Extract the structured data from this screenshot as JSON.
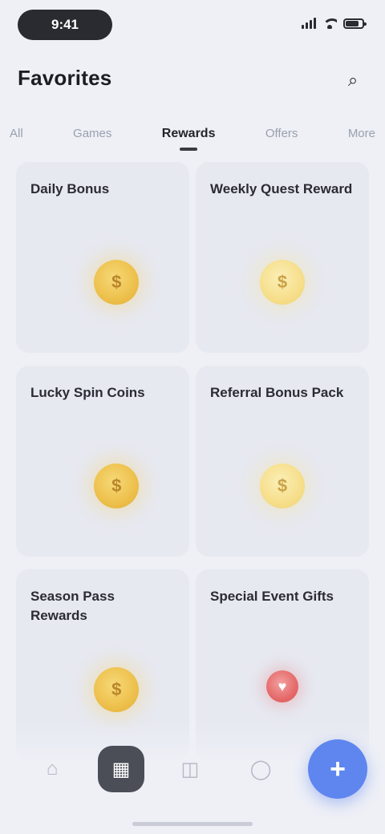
{
  "status": {
    "time": "9:41",
    "icons": [
      "signal-icon",
      "wifi-icon",
      "battery-icon"
    ]
  },
  "header": {
    "title": "Favorites",
    "action_icon": "search-icon",
    "action_glyph": "⌕"
  },
  "tabs": [
    {
      "label": "All",
      "active": false
    },
    {
      "label": "Games",
      "active": false
    },
    {
      "label": "Rewards",
      "active": true
    },
    {
      "label": "Offers",
      "active": false
    },
    {
      "label": "More",
      "active": false
    }
  ],
  "cards": [
    {
      "title": "Daily Bonus",
      "icon": "coin-icon",
      "glyph": "$"
    },
    {
      "title": "Weekly Quest Reward",
      "icon": "coin-icon",
      "glyph": "$"
    },
    {
      "title": "Lucky Spin Coins",
      "icon": "coin-icon",
      "glyph": "$"
    },
    {
      "title": "Referral Bonus Pack",
      "icon": "coin-icon",
      "glyph": "$"
    },
    {
      "title": "Season Pass Rewards",
      "icon": "coin-icon",
      "glyph": "$"
    },
    {
      "title": "Special Event Gifts",
      "icon": "gift-icon",
      "glyph": "♥"
    }
  ],
  "bottom_nav": [
    {
      "icon": "home-icon",
      "glyph": "⌂",
      "active": false
    },
    {
      "icon": "grid-icon",
      "glyph": "▦",
      "active": true
    },
    {
      "icon": "chat-icon",
      "glyph": "◫",
      "active": false
    },
    {
      "icon": "profile-icon",
      "glyph": "◯",
      "active": false
    }
  ],
  "fab": {
    "icon": "plus-icon",
    "glyph": "+"
  },
  "colors": {
    "background": "#eef0f6",
    "card": "#e7e9f1",
    "coin": "#eec24f",
    "accent": "#5f86ef",
    "nav_active": "#4b4e57"
  }
}
